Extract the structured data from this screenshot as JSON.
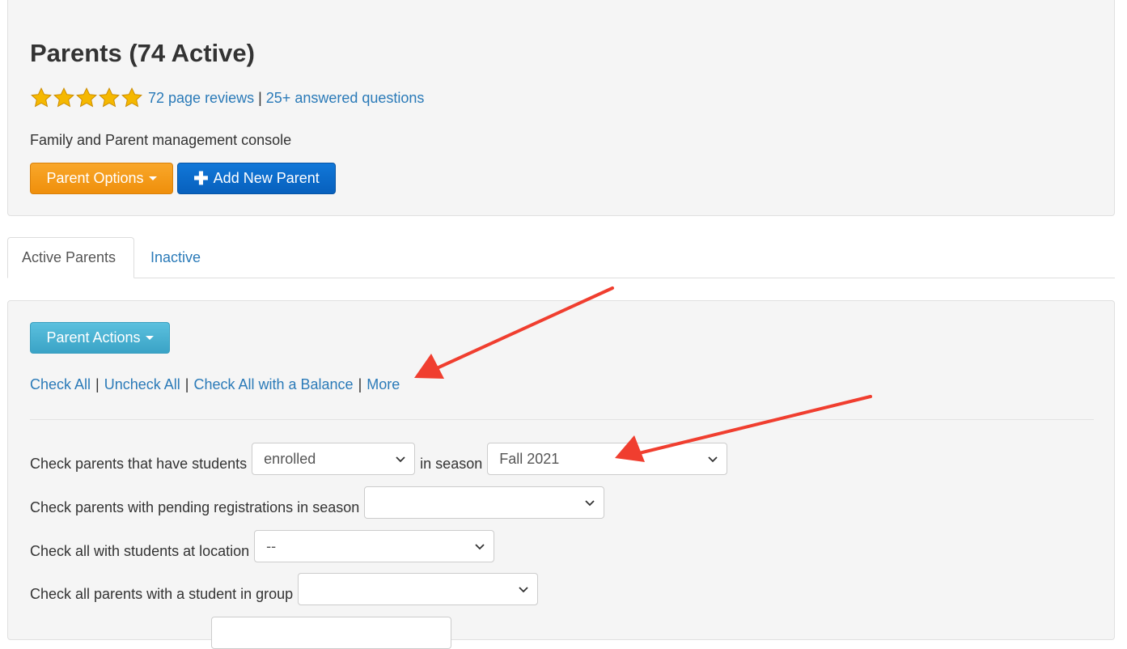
{
  "header": {
    "title": "Parents (74 Active)",
    "rating_stars": 5,
    "reviews_link": "72 page reviews",
    "separator": "|",
    "questions_link": "25+ answered questions",
    "subtitle": "Family and Parent management console",
    "parent_options_label": "Parent Options",
    "add_parent_label": "Add New Parent"
  },
  "tabs": [
    {
      "label": "Active Parents",
      "active": true
    },
    {
      "label": "Inactive",
      "active": false
    }
  ],
  "actions": {
    "parent_actions_label": "Parent Actions",
    "links": [
      "Check All",
      "Uncheck All",
      "Check All with a Balance",
      "More"
    ],
    "separator": "|"
  },
  "filters": {
    "students_label": "Check parents that have students",
    "students_status_value": "enrolled",
    "season_label": "in season",
    "season_value": "Fall 2021",
    "pending_label": "Check parents with pending registrations in season",
    "pending_value": "",
    "location_label": "Check all with students at location",
    "location_value": "--",
    "group_label": "Check all parents with a student in group",
    "group_value": ""
  },
  "colors": {
    "link": "#2a7ab8",
    "orange_button": "#f39a1b",
    "blue_button": "#0a6acb",
    "teal_button": "#46b0d3",
    "annotation_arrow": "#f03e2f",
    "star": "#f5b800"
  },
  "icons": {
    "star": "star-icon",
    "caret": "caret-down-icon",
    "plus": "plus-icon",
    "chevron": "chevron-down-icon"
  }
}
